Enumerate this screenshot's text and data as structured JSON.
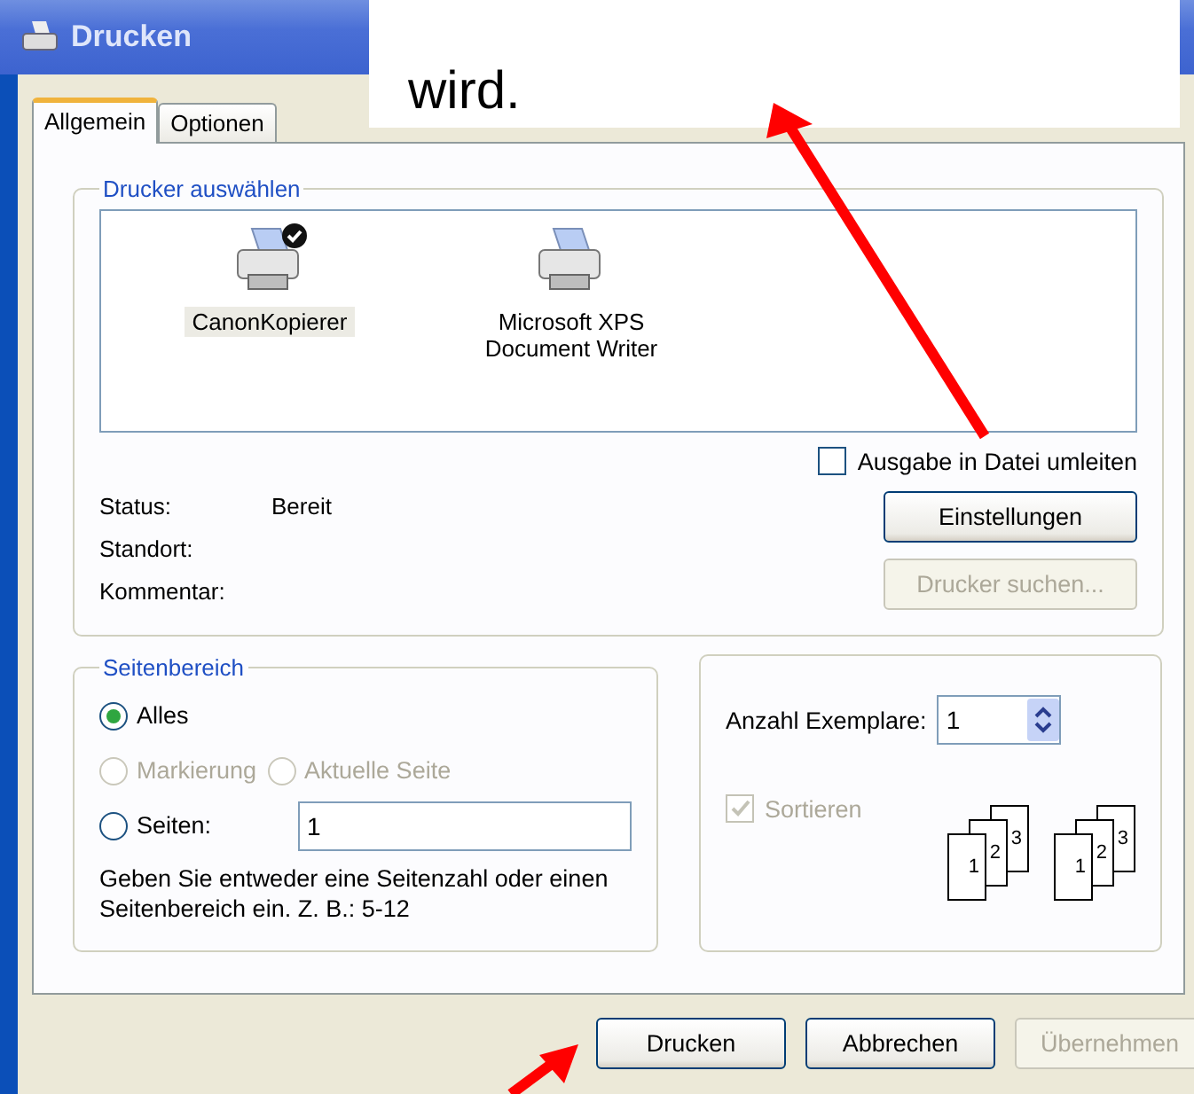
{
  "window": {
    "title": "Drucken"
  },
  "callout": {
    "text": "wird."
  },
  "tabs": [
    {
      "label": "Allgemein",
      "selected": true
    },
    {
      "label": "Optionen",
      "selected": false
    }
  ],
  "printer_group": {
    "title": "Drucker auswählen",
    "printers": [
      {
        "name": "CanonKopierer",
        "selected": true,
        "default": true
      },
      {
        "name": "Microsoft XPS Document Writer",
        "selected": false,
        "default": false
      }
    ],
    "print_to_file": {
      "label": "Ausgabe in Datei umleiten",
      "checked": false
    },
    "info": [
      {
        "label": "Status:",
        "value": "Bereit"
      },
      {
        "label": "Standort:"
      },
      {
        "label": "Kommentar:"
      }
    ],
    "buttons": [
      {
        "label": "Einstellungen",
        "disabled": false
      },
      {
        "label": "Drucker suchen...",
        "disabled": true
      }
    ]
  },
  "page_range": {
    "title": "Seitenbereich",
    "options": [
      {
        "label": "Alles",
        "selected": true,
        "disabled": false
      },
      {
        "label": "Markierung",
        "selected": false,
        "disabled": true
      },
      {
        "label": "Aktuelle Seite",
        "selected": false,
        "disabled": true
      },
      {
        "label": "Seiten:",
        "selected": false,
        "disabled": false
      }
    ],
    "pages_value": "1",
    "hint": "Geben Sie entweder eine Seitenzahl oder einen Seitenbereich ein. Z. B.: 5-12"
  },
  "copies": {
    "label": "Anzahl Exemplare:",
    "value": "1",
    "collate": {
      "label": "Sortieren",
      "checked": true,
      "disabled": true
    },
    "collate_groups": [
      [
        "1",
        "2",
        "3"
      ],
      [
        "1",
        "2",
        "3"
      ]
    ]
  },
  "footer_buttons": [
    {
      "label": "Drucken",
      "disabled": false
    },
    {
      "label": "Abbrechen",
      "disabled": false
    },
    {
      "label": "Übernehmen",
      "disabled": true
    }
  ]
}
